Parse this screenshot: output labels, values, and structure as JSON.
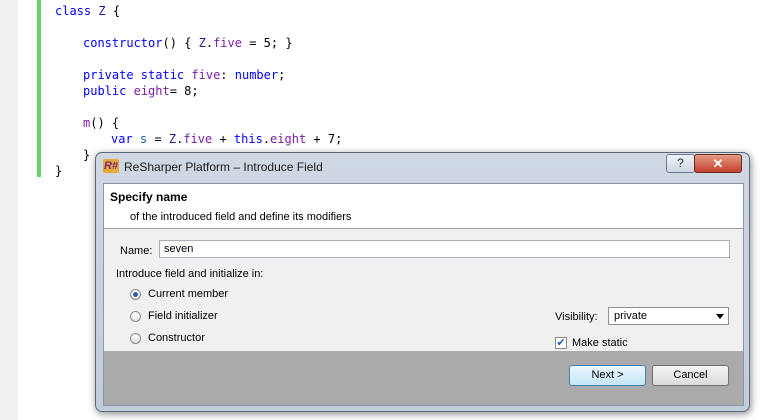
{
  "editor": {
    "lines": [
      "class Z {",
      "constructor() { Z.five = 5; }",
      "private static five: number;",
      "public eight= 8;",
      "m() {",
      "var s = Z.five + this.eight + 7;",
      "}",
      "}"
    ]
  },
  "dialog": {
    "title": "ReSharper Platform – Introduce Field",
    "app_icon": "R#",
    "help_glyph": "?",
    "close_glyph": "✕",
    "header_title": "Specify name",
    "header_subtitle": "of the introduced field and define its modifiers",
    "name_label": "Name:",
    "name_value": "seven",
    "introduce_label": "Introduce field and initialize in:",
    "radio_options": [
      {
        "label": "Current member",
        "selected": true
      },
      {
        "label": "Field initializer",
        "selected": false
      },
      {
        "label": "Constructor",
        "selected": false
      }
    ],
    "visibility_label": "Visibility:",
    "visibility_value": "private",
    "make_static_label": "Make static",
    "make_static_checked": true,
    "next_label": "Next >",
    "cancel_label": "Cancel"
  },
  "colors": {
    "change_bar": "#6ccf6c",
    "keyword": "#0000ff",
    "footer": "#aaaaaa"
  }
}
